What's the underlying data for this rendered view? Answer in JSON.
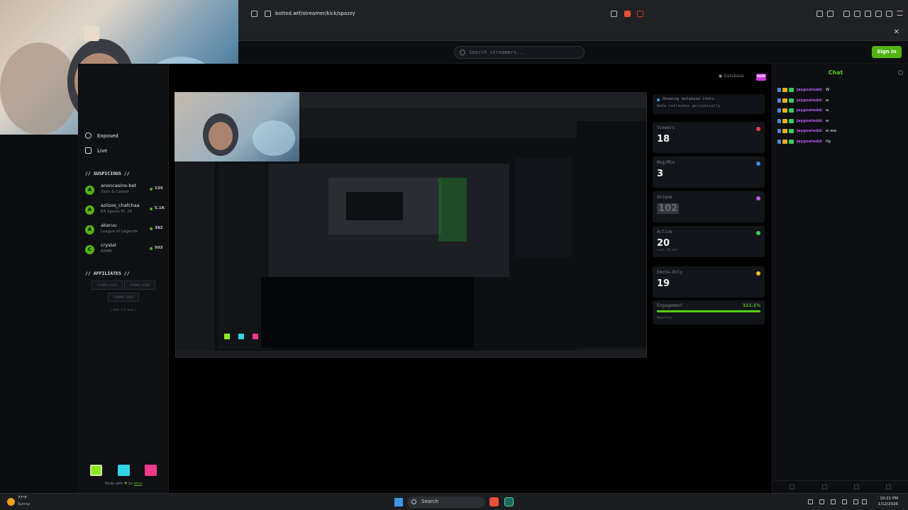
{
  "browser": {
    "url": "botted.wtf/streamer/kick/spazzy",
    "close_glyph": "✕"
  },
  "header": {
    "search_placeholder": "Search streamers...",
    "sign_in_label": "Sign In"
  },
  "sidebar": {
    "nav": [
      {
        "label": "Exposed",
        "icon": "eye-icon"
      },
      {
        "label": "Live",
        "icon": "tv-icon"
      }
    ],
    "suspicious_title": "// SUSPICIOUS //",
    "suspicious": [
      {
        "initial": "A",
        "name": "anoncasino-bet",
        "category": "Slots & Casino",
        "count": "134"
      },
      {
        "initial": "A",
        "name": "aziizos_chafchaa",
        "category": "EA Sports FC 26",
        "count": "5.1K"
      },
      {
        "initial": "A",
        "name": "akaruu",
        "category": "League of Legends",
        "count": "382"
      },
      {
        "initial": "C",
        "name": "crystal",
        "category": "ASMR",
        "count": "503"
      }
    ],
    "affiliates_title": "// AFFILIATES //",
    "affiliates": [
      "CASINO LOGO",
      "CASINO LOGO",
      "CASINO LOGO"
    ],
    "affiliates_note": "[ ADS 1.0 slots ]",
    "made_with_prefix": "Made with",
    "made_with_heart": "♥",
    "made_with_by": "by",
    "made_with_author": "whiz",
    "theme_colors": [
      "#8ee81a",
      "#34d4e8",
      "#ee3a8c"
    ]
  },
  "stats": {
    "database_label": "Database",
    "new_badge": "NEW",
    "note_line1": "Showing database stats",
    "note_line2": "Data refreshes periodically",
    "cards": [
      {
        "label": "Viewers",
        "value": "18",
        "sub": "",
        "icon": "eye-icon",
        "color": "#e83a4a"
      },
      {
        "label": "Msg/Min",
        "value": "3",
        "sub": "",
        "icon": "chat-icon",
        "color": "#3a8ae8"
      },
      {
        "label": "Unique",
        "value": "102",
        "sub": "",
        "icon": "users-icon",
        "color": "#b85ae8"
      },
      {
        "label": "Active",
        "value": "20",
        "sub": "Last 30 min",
        "icon": "check-icon",
        "color": "#3acd5a"
      },
      {
        "label": "Emote-Only",
        "value": "19",
        "sub": "",
        "icon": "smile-icon",
        "color": "#e8c21a"
      }
    ],
    "engagement_label": "Engagement",
    "engagement_value": "111.1%",
    "engagement_fill": 1.0,
    "engagement_status": "Healthy"
  },
  "chat": {
    "title": "Chat",
    "messages": [
      {
        "user": "jaygoatedd:",
        "text": "W"
      },
      {
        "user": "jaygoatedd:",
        "text": "w"
      },
      {
        "user": "jaygoatedd:",
        "text": "w"
      },
      {
        "user": "jaygoatedd:",
        "text": "w"
      },
      {
        "user": "jaygoatedd:",
        "text": "w ww"
      },
      {
        "user": "jaygoatedd:",
        "text": "lfg"
      }
    ]
  },
  "taskbar": {
    "weather_temp": "77°F",
    "weather_text": "Sunny",
    "search_label": "Search",
    "time": "10:21 PM",
    "date": "1/12/2026"
  }
}
